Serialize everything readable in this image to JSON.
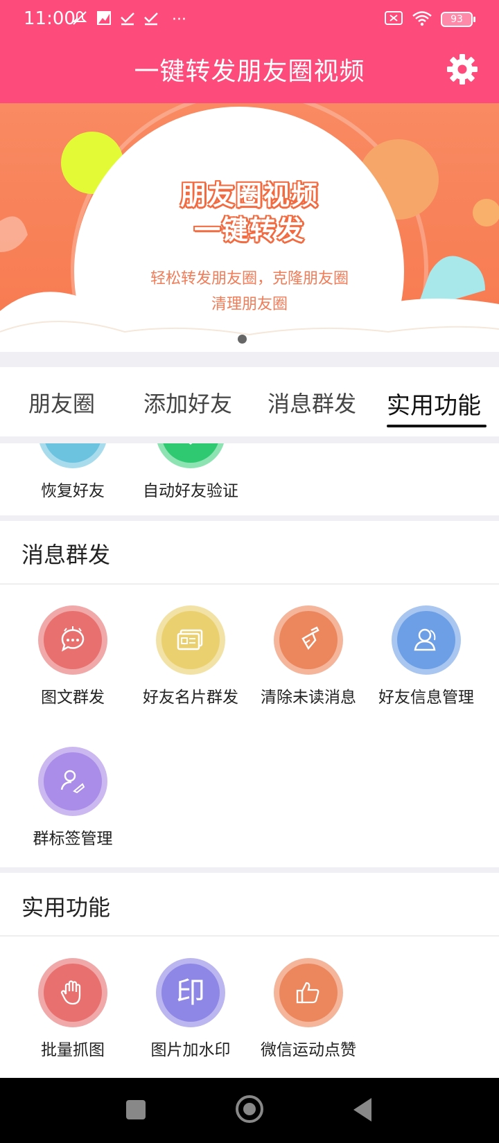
{
  "status_bar": {
    "time": "11:00",
    "dots": "···",
    "battery": "93"
  },
  "header": {
    "title": "一键转发朋友圈视频"
  },
  "banner": {
    "headline_line1": "朋友圈视频",
    "headline_line2": "一键转发",
    "sub_line1": "轻松转发朋友圈，克隆朋友圈",
    "sub_line2": "清理朋友圈"
  },
  "tabs": [
    {
      "label": "朋友圈"
    },
    {
      "label": "添加好友"
    },
    {
      "label": "消息群发"
    },
    {
      "label": "实用功能",
      "active": true
    }
  ],
  "partial_section": {
    "items": [
      {
        "label": "恢复好友",
        "icon": "restore-friend-icon",
        "color": "#6cc3e0"
      },
      {
        "label": "自动好友验证",
        "icon": "shield-check-icon",
        "color": "#2ec971"
      }
    ]
  },
  "message_section": {
    "title": "消息群发",
    "items": [
      {
        "label": "图文群发",
        "icon": "chat-bubble-icon",
        "color": "#e8706f"
      },
      {
        "label": "好友名片群发",
        "icon": "card-icon",
        "color": "#ead06f"
      },
      {
        "label": "清除未读消息",
        "icon": "broom-icon",
        "color": "#ec875d"
      },
      {
        "label": "好友信息管理",
        "icon": "user-icon",
        "color": "#6c9fe6"
      },
      {
        "label": "群标签管理",
        "icon": "user-tag-icon",
        "color": "#a98de8"
      }
    ]
  },
  "tools_section": {
    "title": "实用功能",
    "items": [
      {
        "label": "批量抓图",
        "icon": "hand-icon",
        "color": "#e8706f"
      },
      {
        "label": "图片加水印",
        "icon": "stamp-icon",
        "color": "#8e87e6",
        "glyph": "印"
      },
      {
        "label": "微信运动点赞",
        "icon": "thumbs-up-icon",
        "color": "#ec875d"
      }
    ]
  }
}
